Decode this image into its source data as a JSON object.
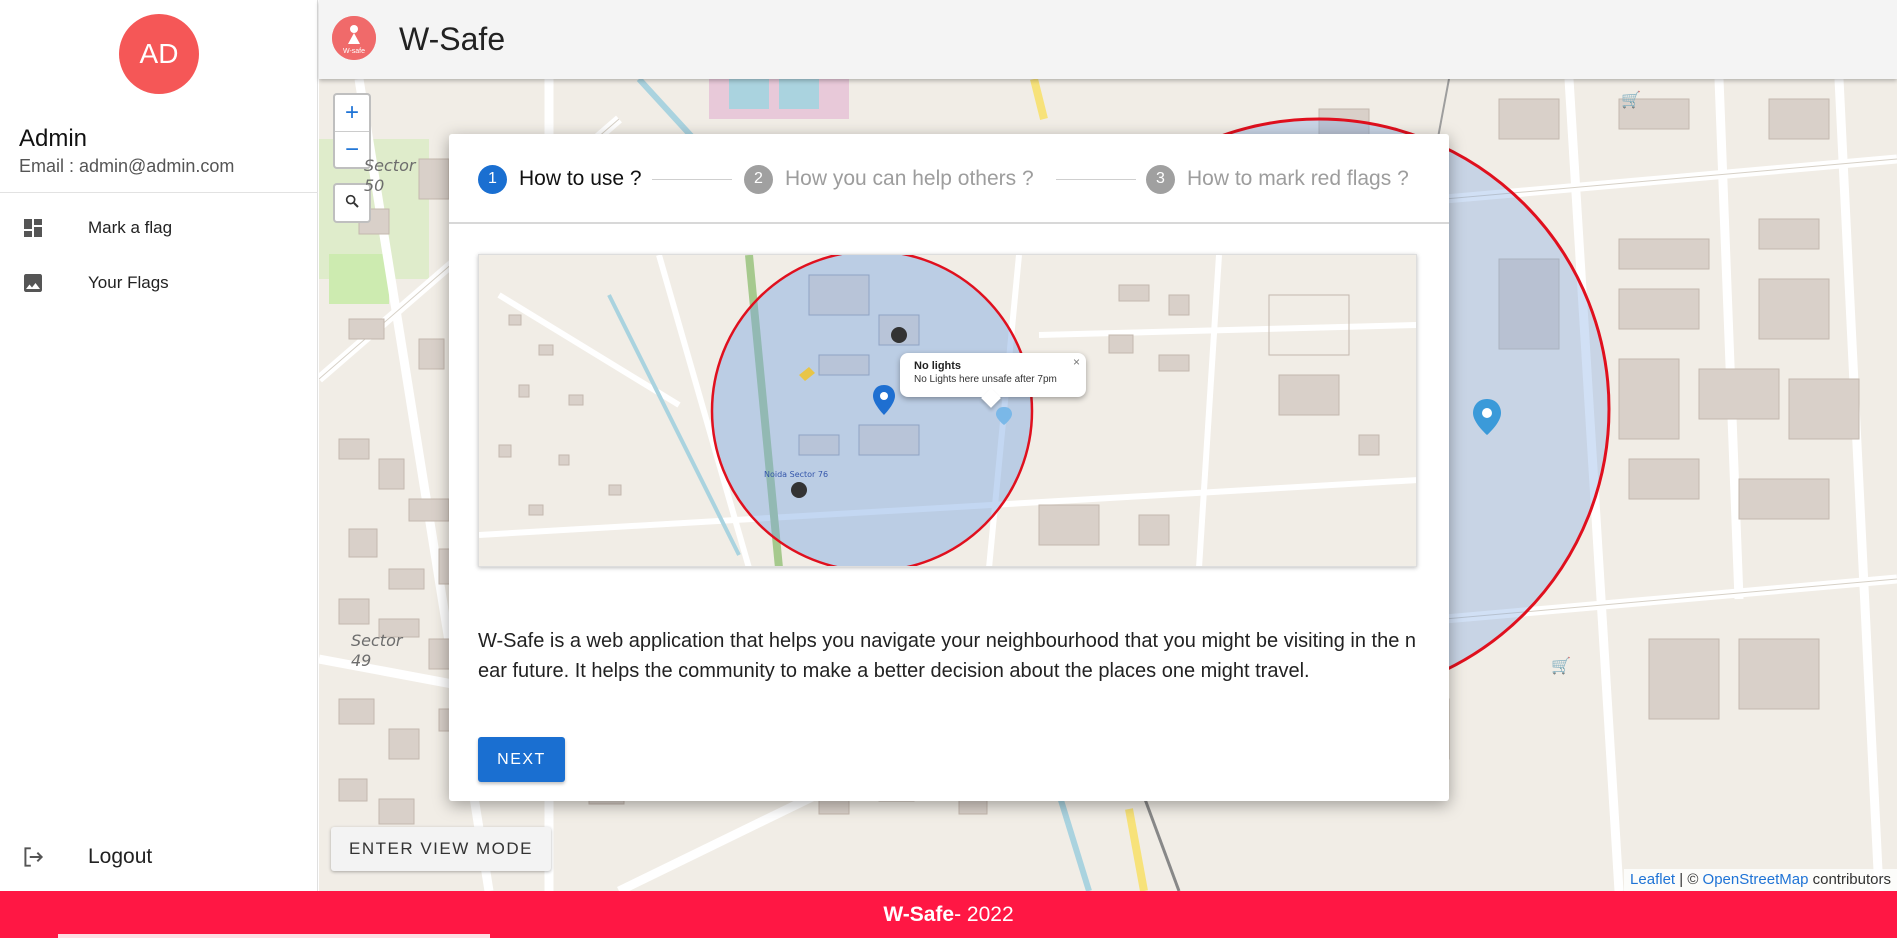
{
  "sidebar": {
    "avatar_initials": "AD",
    "user_name": "Admin",
    "user_email": "Email : admin@admin.com",
    "items": [
      {
        "label": "Mark a flag",
        "icon": "dashboard-icon"
      },
      {
        "label": "Your Flags",
        "icon": "image-icon"
      }
    ],
    "logout_label": "Logout",
    "logout_icon": "logout-icon"
  },
  "header": {
    "logo_text": "W-safe",
    "title": "W-Safe"
  },
  "map": {
    "zoom_in": "+",
    "zoom_out": "−",
    "labels": [
      "Sector 50",
      "Sector 49"
    ],
    "view_mode_label": "ENTER VIEW MODE",
    "attribution": {
      "leaflet": "Leaflet",
      "separator": " | © ",
      "osm": "OpenStreetMap",
      "suffix": " contributors"
    }
  },
  "dialog": {
    "steps": [
      {
        "number": "1",
        "label": "How to use ?",
        "active": true
      },
      {
        "number": "2",
        "label": "How you can help others ?",
        "active": false
      },
      {
        "number": "3",
        "label": "How to mark red flags ?",
        "active": false
      }
    ],
    "preview": {
      "popup_title": "No lights",
      "popup_text": "No Lights here unsafe after 7pm",
      "popup_close": "×",
      "map_label": "Noida Sector 76"
    },
    "description": "W-Safe is a web application that helps you navigate your neighbourhood that you might be visiting in the near future. It helps the community to make a better decision about the places one might travel.",
    "next_label": "NEXT"
  },
  "footer": {
    "brand": "W-Safe",
    "suffix": " - 2022"
  },
  "colors": {
    "accent": "#1a6fd1",
    "footer": "#ff1744",
    "avatar": "#f55757",
    "flag_circle": "#e0101e"
  }
}
